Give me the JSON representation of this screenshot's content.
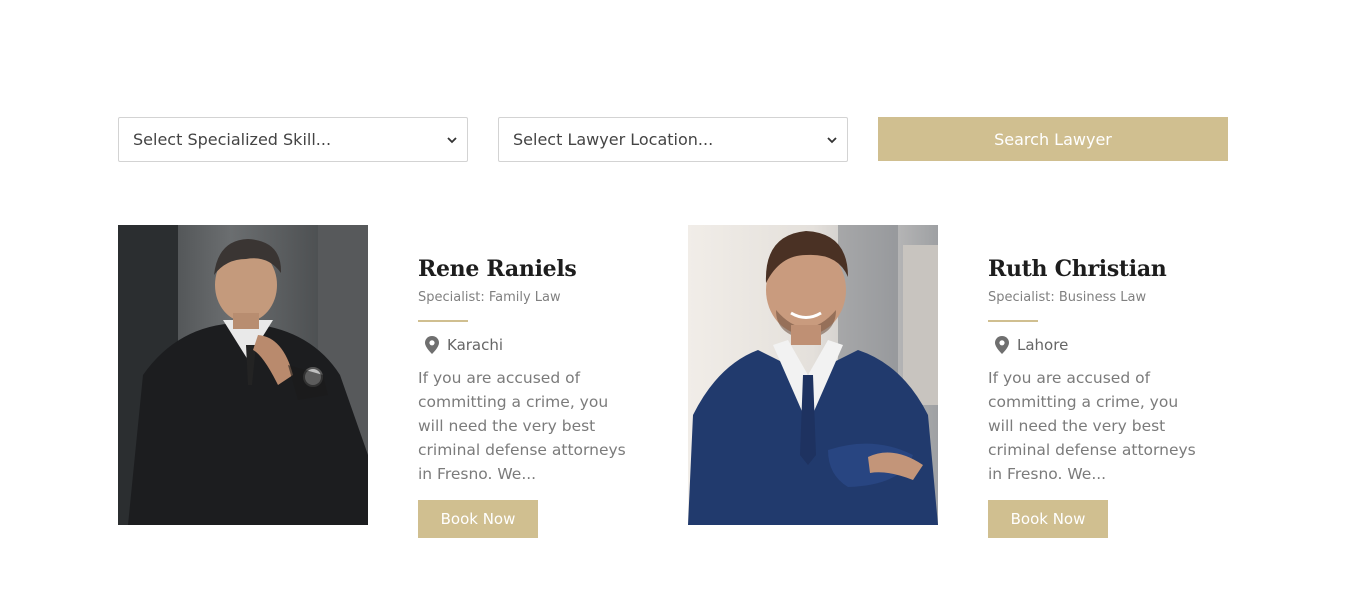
{
  "search": {
    "skill_select": {
      "selected": "Select Specialized Skill..."
    },
    "location_select": {
      "selected": "Select Lawyer Location..."
    },
    "search_button": "Search Lawyer"
  },
  "lawyers": [
    {
      "name": "Rene Raniels",
      "specialist": "Specialist: Family Law",
      "location": "Karachi",
      "description": "If you are accused of committing a crime, you will need the very best criminal defense attorneys in Fresno. We...",
      "button": "Book Now"
    },
    {
      "name": "Ruth Christian",
      "specialist": "Specialist: Business Law",
      "location": "Lahore",
      "description": "If you are accused of committing a crime, you will need the very best criminal defense attorneys in Fresno. We...",
      "button": "Book Now"
    }
  ],
  "colors": {
    "accent": "#d0bf90",
    "heading": "#1d1d1d",
    "body_text": "#7b7b7b"
  },
  "icons": {
    "location": "map-pin-icon",
    "dropdown": "chevron-down-icon"
  }
}
